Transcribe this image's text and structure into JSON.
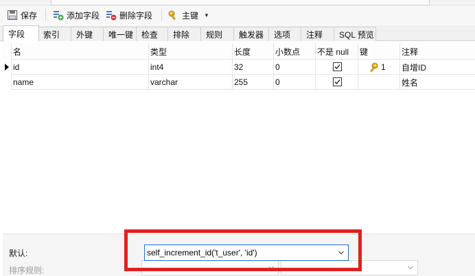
{
  "toolbar": {
    "save_label": "保存",
    "add_field_label": "添加字段",
    "delete_field_label": "删除字段",
    "primary_key_label": "主键"
  },
  "tabs": [
    {
      "label": "字段",
      "active": true
    },
    {
      "label": "索引"
    },
    {
      "label": "外键"
    },
    {
      "label": "唯一键"
    },
    {
      "label": "检查"
    },
    {
      "label": "排除"
    },
    {
      "label": "规则"
    },
    {
      "label": "触发器"
    },
    {
      "label": "选项"
    },
    {
      "label": "注释"
    },
    {
      "label": "SQL 预览"
    }
  ],
  "columns": {
    "name": "名",
    "type": "类型",
    "length": "长度",
    "decimals": "小数点",
    "not_null": "不是 null",
    "key": "键",
    "comment": "注释"
  },
  "rows": [
    {
      "name": "id",
      "type": "int4",
      "length": "32",
      "decimals": "0",
      "not_null": true,
      "key": "1",
      "key_icon": "key-icon",
      "comment": "自增ID",
      "current": true
    },
    {
      "name": "name",
      "type": "varchar",
      "length": "255",
      "decimals": "0",
      "not_null": true,
      "key": "",
      "comment": "姓名",
      "current": false
    }
  ],
  "properties": {
    "default_label": "默认:",
    "default_value": "self_increment_id('t_user', 'id')",
    "collation_label": "排序规则:"
  },
  "colors": {
    "highlight_border": "#e0201f",
    "focus_border": "#1a6fd0"
  }
}
